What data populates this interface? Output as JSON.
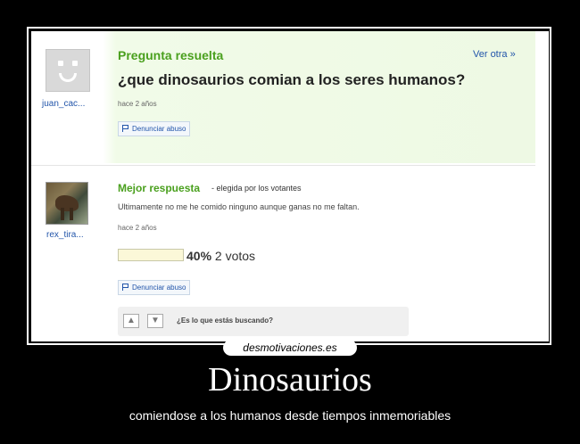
{
  "question_block": {
    "status_label": "Pregunta resuelta",
    "see_other_label": "Ver otra »",
    "question": "¿que dinosaurios comian a los seres humanos?",
    "asker": "juan_cac...",
    "time_ago": "hace 2 años",
    "report_label": "Denunciar abuso",
    "avatar_icon": "smiley-placeholder-icon"
  },
  "answer_block": {
    "best_answer_label": "Mejor respuesta",
    "chosen_by": "- elegida por los votantes",
    "answer_text": "Ultimamente no me he comido ninguno aunque ganas no me faltan.",
    "answerer": "rex_tira...",
    "time_ago": "hace 2 años",
    "percent": "40%",
    "percent_value": 0.4,
    "votes": "2 votos",
    "report_label": "Denunciar abuso",
    "lookup_question": "¿Es lo que estás buscando?",
    "thumb_up_icon": "thumbs-up-icon",
    "thumb_down_icon": "thumbs-down-icon"
  },
  "poster": {
    "site_tag": "desmotivaciones.es",
    "title": "Dinosaurios",
    "subtitle": "comiendose a los humanos desde tiempos inmemoriables"
  },
  "colors": {
    "background": "#000000",
    "green_title": "#4aa01e",
    "link_blue": "#2255aa"
  }
}
